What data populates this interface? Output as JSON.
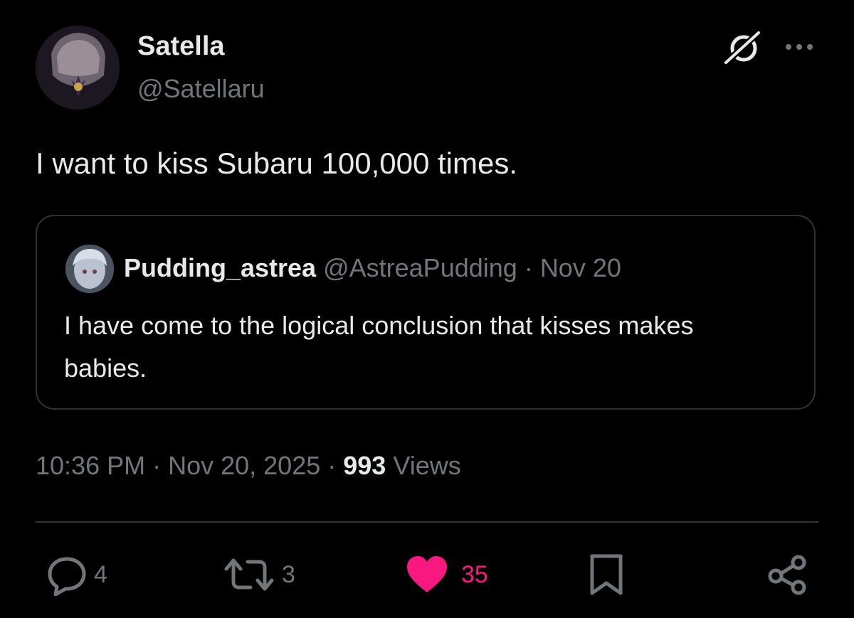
{
  "post": {
    "author": {
      "display_name": "Satella",
      "handle": "@Satellaru"
    },
    "text": "I want to kiss Subaru 100,000 times.",
    "icons": {
      "grok": "grok-slash-icon",
      "more": "more-horizontal-icon"
    }
  },
  "quote": {
    "display_name": "Pudding_astrea",
    "handle": "@AstreaPudding",
    "separator": " · ",
    "date": "Nov 20",
    "text": "I have come to the logical conclusion that kisses makes babies."
  },
  "meta": {
    "time": "10:36 PM",
    "sep1": " · ",
    "date": "Nov 20, 2025",
    "sep2": " · ",
    "views_count": "993",
    "views_label": " Views"
  },
  "actions": {
    "replies": "4",
    "reposts": "3",
    "likes": "35",
    "icons": [
      "reply-icon",
      "repost-icon",
      "like-heart-icon",
      "bookmark-icon",
      "share-icon"
    ]
  },
  "colors": {
    "background": "#000000",
    "primary_text": "#e7e9ea",
    "secondary_text": "#71767b",
    "border": "#2f3336",
    "like_active": "#f91880"
  }
}
